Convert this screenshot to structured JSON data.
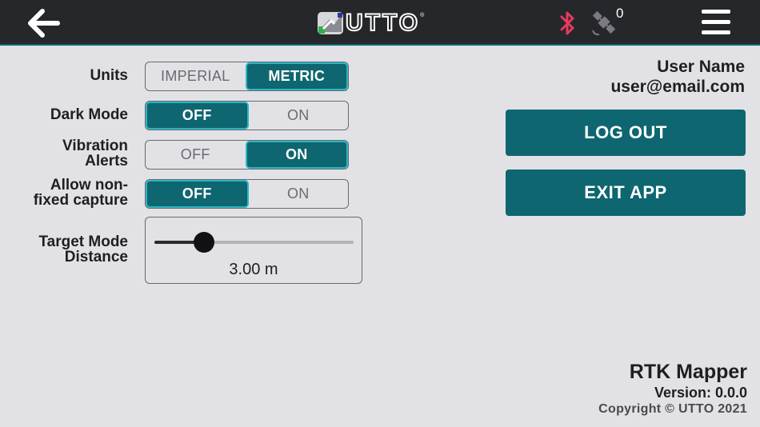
{
  "header": {
    "logo_text": "UTTO",
    "logo_reg": "®",
    "satellite_count": "0"
  },
  "settings": {
    "units": {
      "label": "Units",
      "options": [
        "IMPERIAL",
        "METRIC"
      ],
      "selected": "METRIC"
    },
    "dark_mode": {
      "label": "Dark Mode",
      "options": [
        "OFF",
        "ON"
      ],
      "selected": "OFF"
    },
    "vibration_alerts": {
      "label_line1": "Vibration",
      "label_line2": "Alerts",
      "options": [
        "OFF",
        "ON"
      ],
      "selected": "ON"
    },
    "allow_non_fixed": {
      "label_line1": "Allow non-",
      "label_line2": "fixed capture",
      "options": [
        "OFF",
        "ON"
      ],
      "selected": "OFF"
    },
    "target_mode_distance": {
      "label_line1": "Target Mode",
      "label_line2": "Distance",
      "value_text": "3.00 m",
      "fraction": 0.25
    }
  },
  "account": {
    "user_name": "User Name",
    "user_email": "user@email.com",
    "logout_label": "LOG OUT",
    "exit_label": "EXIT APP"
  },
  "app_info": {
    "name": "RTK Mapper",
    "version": "Version: 0.0.0",
    "copyright": "Copyright © UTTO 2021"
  },
  "colors": {
    "accent": "#0e6670",
    "accent_border": "#2ab7c4",
    "topbar": "#26272b",
    "bluetooth": "#e8385f",
    "background": "#e2e2e6"
  },
  "icons": {
    "back": "arrow-left-icon",
    "bluetooth": "bluetooth-icon",
    "satellite": "satellite-icon",
    "menu": "hamburger-menu-icon"
  }
}
